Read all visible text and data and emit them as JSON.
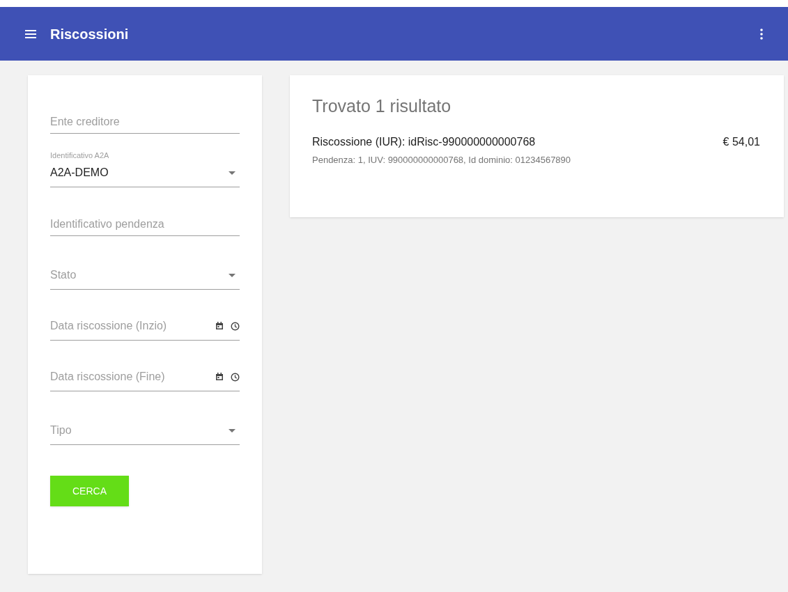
{
  "app_bar": {
    "title": "Riscossioni"
  },
  "filters": [
    {
      "kind": "text",
      "placeholder": "Ente creditore"
    },
    {
      "kind": "select",
      "label": "Identificativo A2A",
      "value": "A2A-DEMO"
    },
    {
      "kind": "text",
      "placeholder": "Identificativo pendenza"
    },
    {
      "kind": "select",
      "placeholder": "Stato"
    },
    {
      "kind": "datetime",
      "placeholder": "Data riscossione (Inzio)"
    },
    {
      "kind": "datetime",
      "placeholder": "Data riscossione (Fine)"
    },
    {
      "kind": "select",
      "placeholder": "Tipo"
    }
  ],
  "search_button": "CERCA",
  "results": {
    "heading": "Trovato 1 risultato",
    "items": [
      {
        "title": "Riscossione (IUR): idRisc-990000000000768",
        "subtitle": "Pendenza: 1, IUV: 990000000000768, Id dominio: 01234567890",
        "amount": "€ 54,01"
      }
    ]
  }
}
